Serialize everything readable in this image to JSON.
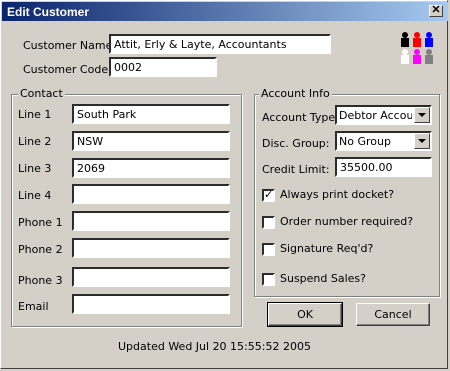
{
  "window": {
    "title": "Edit Customer",
    "close_glyph": "✕"
  },
  "customer": {
    "name_label": "Customer Name:",
    "name_value": "Attit, Erly & Layte, Accountants",
    "code_label": "Customer Code",
    "code_value": "0002"
  },
  "contact": {
    "legend": "Contact",
    "fields": [
      {
        "label": "Line 1",
        "value": "South Park"
      },
      {
        "label": "Line 2",
        "value": "NSW"
      },
      {
        "label": "Line 3",
        "value": "2069"
      },
      {
        "label": "Line 4",
        "value": ""
      },
      {
        "label": "Phone 1",
        "value": ""
      },
      {
        "label": "Phone 2",
        "value": ""
      },
      {
        "label": "Phone 3",
        "value": ""
      },
      {
        "label": "Email",
        "value": ""
      }
    ]
  },
  "account": {
    "legend": "Account Info",
    "type_label": "Account Type:",
    "type_value": "Debtor Account",
    "group_label": "Disc. Group:",
    "group_value": "No Group",
    "credit_label": "Credit Limit:",
    "credit_value": "35500.00",
    "checks": [
      {
        "label": "Always print docket?",
        "checked": true
      },
      {
        "label": "Order number required?",
        "checked": false
      },
      {
        "label": "Signature Req'd?",
        "checked": false
      },
      {
        "label": "Suspend Sales?",
        "checked": false
      }
    ]
  },
  "buttons": {
    "ok": "OK",
    "cancel": "Cancel"
  },
  "status": "Updated Wed Jul 20 15:55:52 2005",
  "icon": {
    "name": "people-group-icon",
    "colors": [
      "#000000",
      "#ff0000",
      "#0000ff",
      "#ffffff",
      "#ff00ff",
      "#808080"
    ]
  }
}
